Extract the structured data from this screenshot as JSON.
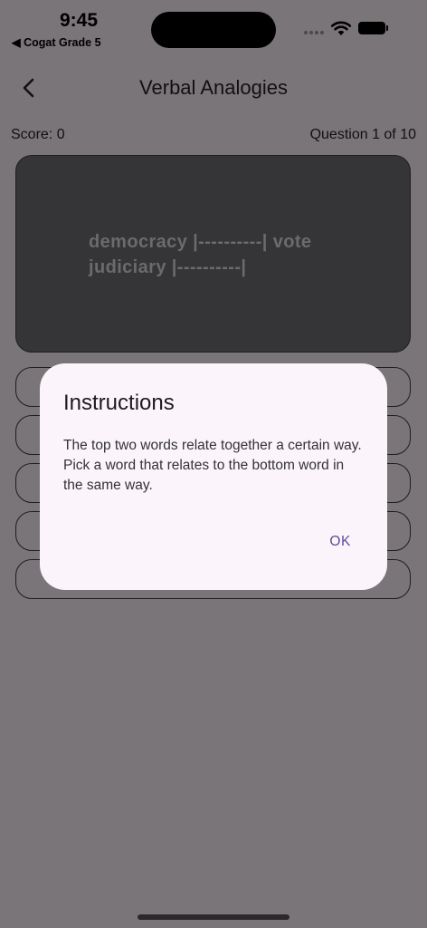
{
  "status_bar": {
    "time": "9:45",
    "back_app": "◀ Cogat Grade 5"
  },
  "nav": {
    "title": "Verbal Analogies"
  },
  "quiz": {
    "score": "Score: 0",
    "question_counter": "Question 1 of 10",
    "question_line_1": "democracy |----------| vote",
    "question_line_2": "judiciary |----------|"
  },
  "dialog": {
    "title": "Instructions",
    "body": "The top two words relate together a certain way.  Pick a word that relates to the bottom word in the same way.",
    "ok_label": "OK"
  }
}
